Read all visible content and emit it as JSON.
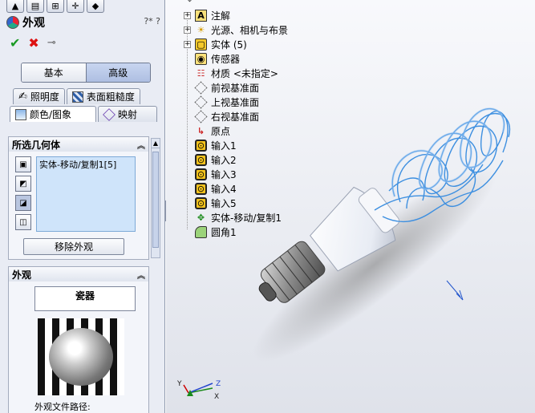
{
  "panel": {
    "title": "外观",
    "help": "?* ?",
    "mode_tabs": {
      "basic": "基本",
      "advanced": "高级"
    },
    "tabs_row1": [
      {
        "label": "照明度",
        "icon": "bulb-icon"
      },
      {
        "label": "表面粗糙度",
        "icon": "texture-icon"
      }
    ],
    "tabs_row2": [
      {
        "label": "颜色/图象",
        "icon": "image-icon"
      },
      {
        "label": "映射",
        "icon": "mapping-icon"
      }
    ],
    "geometry_section": {
      "title": "所选几何体",
      "selected": [
        "实体-移动/复制1[5]"
      ],
      "remove_button": "移除外观"
    },
    "appearance_section": {
      "title": "外观",
      "material": "瓷器",
      "path_label": "外观文件路径:"
    }
  },
  "tree": {
    "items": [
      {
        "label": "注解",
        "icon": "annotation-icon",
        "expander": "+"
      },
      {
        "label": "光源、相机与布景",
        "icon": "lights-icon",
        "expander": "+"
      },
      {
        "label": "实体 (5)",
        "icon": "solid-bodies-icon",
        "expander": "+"
      },
      {
        "label": "传感器",
        "icon": "sensor-icon",
        "expander": ""
      },
      {
        "label": "材质 <未指定>",
        "icon": "material-icon",
        "expander": ""
      },
      {
        "label": "前视基准面",
        "icon": "plane-icon",
        "expander": ""
      },
      {
        "label": "上视基准面",
        "icon": "plane-icon",
        "expander": ""
      },
      {
        "label": "右视基准面",
        "icon": "plane-icon",
        "expander": ""
      },
      {
        "label": "原点",
        "icon": "origin-icon",
        "expander": ""
      },
      {
        "label": "输入1",
        "icon": "import-icon",
        "expander": ""
      },
      {
        "label": "输入2",
        "icon": "import-icon",
        "expander": ""
      },
      {
        "label": "输入3",
        "icon": "import-icon",
        "expander": ""
      },
      {
        "label": "输入4",
        "icon": "import-icon",
        "expander": ""
      },
      {
        "label": "输入5",
        "icon": "import-icon",
        "expander": ""
      },
      {
        "label": "实体-移动/复制1",
        "icon": "move-copy-icon",
        "expander": ""
      },
      {
        "label": "圆角1",
        "icon": "fillet-icon",
        "expander": ""
      }
    ]
  },
  "triad": {
    "x": "X",
    "y": "Y",
    "z": "Z"
  },
  "colors": {
    "accent": "#aebfe2",
    "highlight": "#cfe4fa",
    "tube_edge": "#3d8fe0"
  }
}
